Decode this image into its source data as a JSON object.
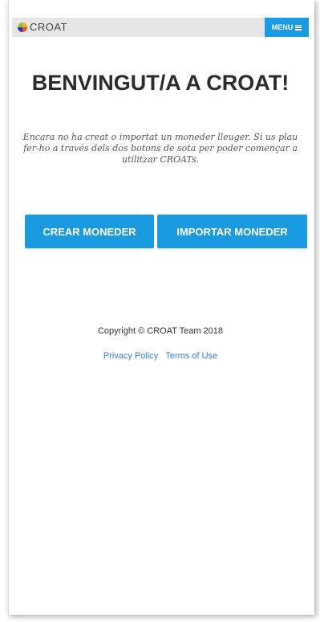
{
  "navbar": {
    "brand_text": "CROAT",
    "brand_icon": "croat-logo-icon",
    "menu_label": "MENU",
    "menu_icon": "hamburger-icon"
  },
  "main": {
    "title": "BENVINGUT/A A CROAT!",
    "intro": "Encara no ha creat o importat un moneder lleuger. Si us plau fer-ho a través dels dos botons de sota per poder començar a utilitzar CROATs.",
    "create_wallet_label": "CREAR MONEDER",
    "import_wallet_label": "IMPORTAR MONEDER"
  },
  "footer": {
    "copyright": "Copyright © CROAT Team 2018",
    "privacy_label": "Privacy Policy",
    "terms_label": "Terms of Use"
  },
  "colors": {
    "accent": "#1a9ae1",
    "navbar_bg": "#e6e6e6",
    "link": "#3d7fd4"
  }
}
